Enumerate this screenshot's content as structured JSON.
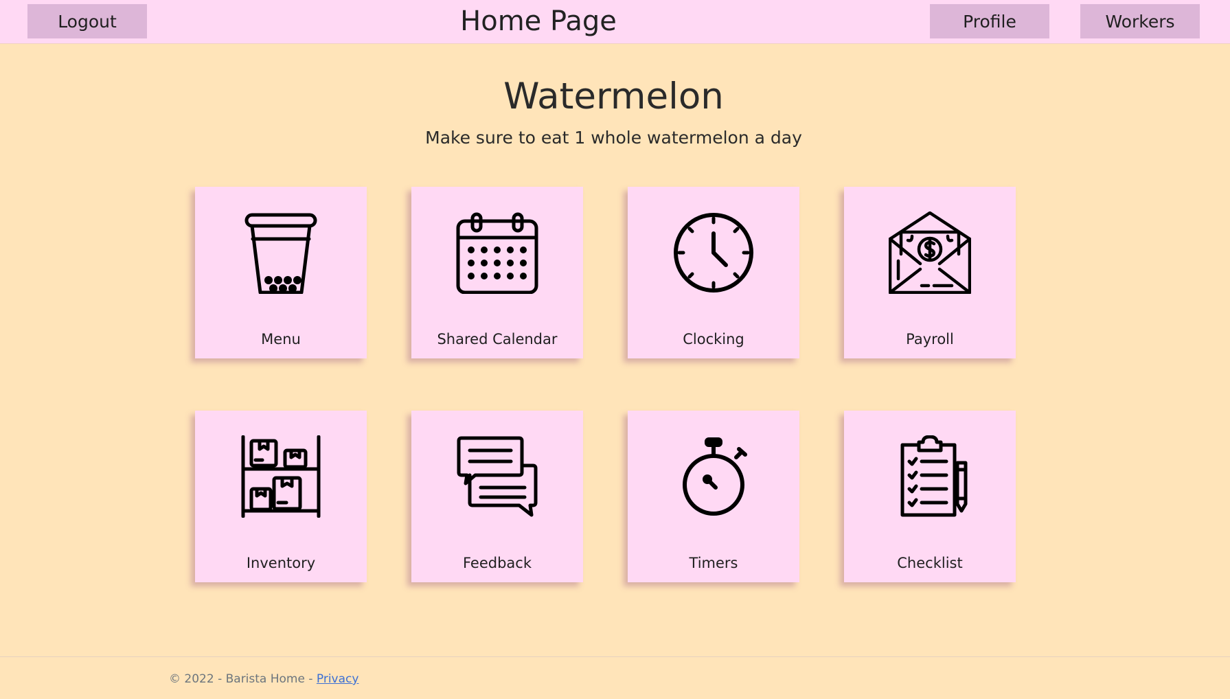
{
  "header": {
    "logout_label": "Logout",
    "title": "Home Page",
    "profile_label": "Profile",
    "workers_label": "Workers"
  },
  "hero": {
    "title": "Watermelon",
    "subtitle": "Make sure to eat 1 whole watermelon a day"
  },
  "tiles": [
    {
      "label": "Menu",
      "icon": "bubble-tea-cup-icon"
    },
    {
      "label": "Shared Calendar",
      "icon": "calendar-icon"
    },
    {
      "label": "Clocking",
      "icon": "clock-icon"
    },
    {
      "label": "Payroll",
      "icon": "money-envelope-icon"
    },
    {
      "label": "Inventory",
      "icon": "shelf-boxes-icon"
    },
    {
      "label": "Feedback",
      "icon": "chat-bubbles-icon"
    },
    {
      "label": "Timers",
      "icon": "stopwatch-icon"
    },
    {
      "label": "Checklist",
      "icon": "clipboard-checklist-icon"
    }
  ],
  "footer": {
    "text": "© 2022 - Barista Home - ",
    "privacy_label": "Privacy"
  },
  "colors": {
    "page_bg": "#ffe4b9",
    "header_bg": "#ffd9f4",
    "button_bg": "#ddb6d8",
    "tile_bg": "#ffd9f4",
    "link": "#3b6fd4"
  }
}
